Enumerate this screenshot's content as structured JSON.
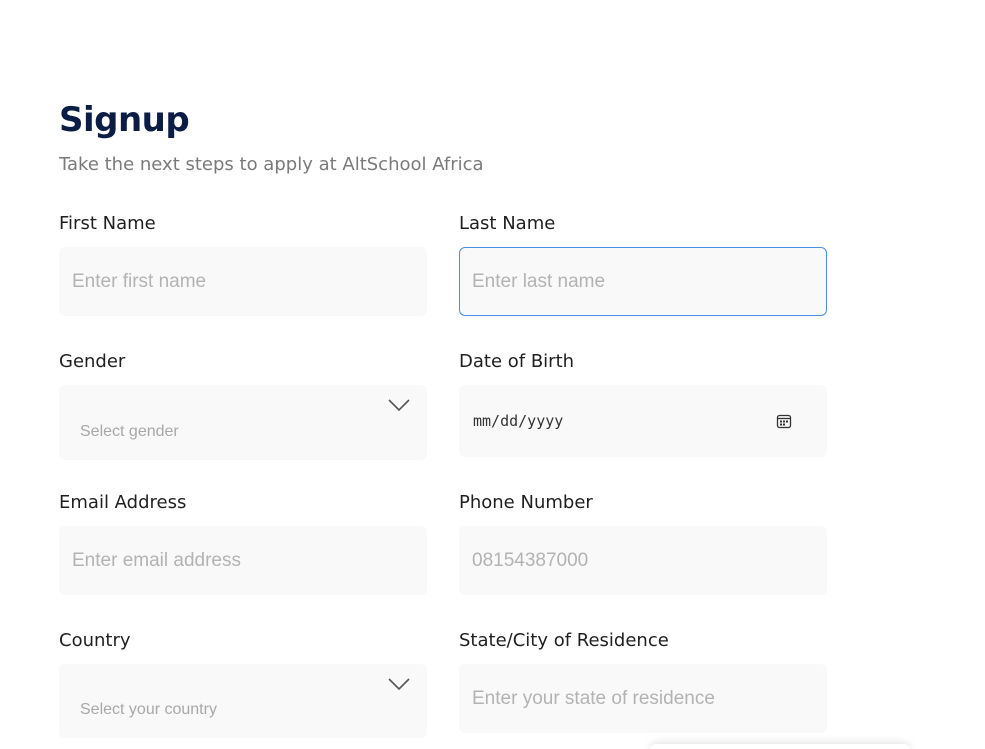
{
  "header": {
    "title": "Signup",
    "subtitle": "Take the next steps to apply at AltSchool Africa"
  },
  "form": {
    "first_name": {
      "label": "First Name",
      "placeholder": "Enter first name"
    },
    "last_name": {
      "label": "Last Name",
      "placeholder": "Enter last name"
    },
    "gender": {
      "label": "Gender",
      "placeholder": "Select gender"
    },
    "dob": {
      "label": "Date of Birth",
      "value": "mm/dd/yyyy"
    },
    "email": {
      "label": "Email Address",
      "placeholder": "Enter email address"
    },
    "phone": {
      "label": "Phone Number",
      "placeholder": "08154387000"
    },
    "country": {
      "label": "Country",
      "placeholder": "Select your country"
    },
    "state": {
      "label": "State/City of Residence",
      "placeholder": "Enter your state of residence"
    }
  },
  "icons": {
    "select": "chevron-down-icon",
    "date": "calendar-icon"
  },
  "colors": {
    "title": "#0b1d45",
    "field_bg": "#f9f9f9",
    "focus_border": "#4a90e2",
    "placeholder": "#b3b3b3"
  }
}
